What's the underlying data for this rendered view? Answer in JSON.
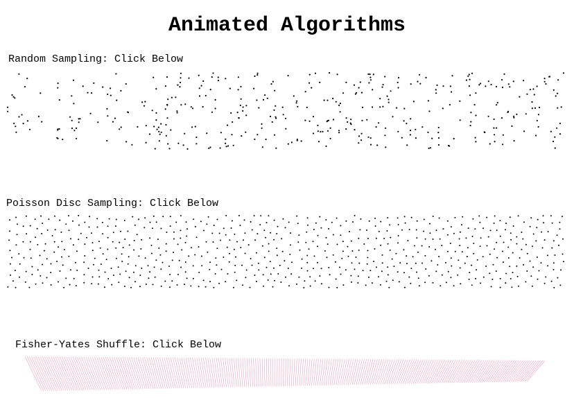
{
  "header": {
    "title": "Animated Algorithms"
  },
  "sections": [
    {
      "id": "random",
      "label": "Random Sampling: Click Below",
      "point_count": 420
    },
    {
      "id": "poisson",
      "label": "Poisson Disc Sampling: Click Below",
      "point_count": 900
    },
    {
      "id": "shuffle",
      "label": "Fisher-Yates Shuffle: Click Below",
      "line_count": 240
    }
  ],
  "colors": {
    "background": "#ffffff",
    "text": "#000000",
    "dots": "#000000",
    "shuffle_lines": "#f0a0b8"
  }
}
